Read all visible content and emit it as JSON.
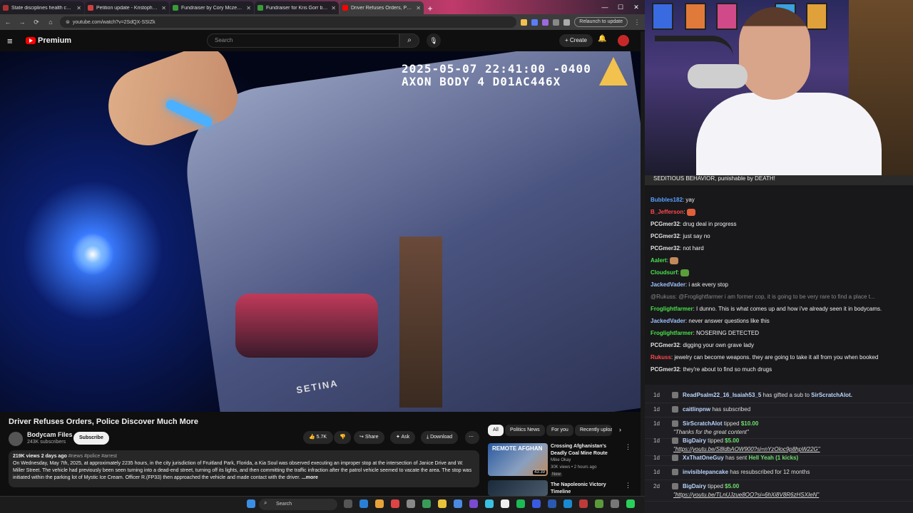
{
  "browser": {
    "tabs": [
      {
        "title": "State disciplines health care pr",
        "color": "#b03030"
      },
      {
        "title": "Petition update - Kristopher's s",
        "color": "#d04040"
      },
      {
        "title": "Fundraiser by Cory Mczenna",
        "color": "#3a9a3a"
      },
      {
        "title": "Fundraiser for Kris Gorr by Kell",
        "color": "#3a9a3a"
      },
      {
        "title": "Driver Refuses Orders, Polic",
        "color": "#ff0000"
      }
    ],
    "new_tab": "+",
    "url": "youtube.com/watch?v=2SdQX-SSIZk",
    "relaunch": "Relaunch to update"
  },
  "youtube": {
    "premium_label": "Premium",
    "search_placeholder": "Search",
    "create_label": "Create",
    "video": {
      "overlay_line1": "2025-05-07 22:41:00 -0400",
      "overlay_line2": "AXON BODY 4 D01AC446X",
      "car_text": "SETINA"
    },
    "title": "Driver Refuses Orders, Police Discover Much More",
    "channel": "Bodycam Files",
    "subscribers": "243K subscribers",
    "subscribe": "Subscribe",
    "likes": "5.7K",
    "share": "Share",
    "ask": "Ask",
    "download": "Download",
    "description": {
      "stats": "219K views  2 days ago",
      "tags": "#news #police #arrest",
      "text": "On Wednesday, May 7th, 2025, at approximately 2235 hours, in the city jurisdiction of Fruitland Park, Florida, a Kia Soul was observed executing an improper stop at the intersection of Janice Drive and W. Miller Street. The vehicle had previously been seen turning into a dead-end street, turning off its lights, and then committing the traffic infraction after the patrol vehicle seemed to vacate the area. The stop was initiated within the parking lot of Mystic Ice Cream. Officer R.(FP33) then approached the vehicle and made contact with the driver.",
      "more": "...more"
    },
    "chips": [
      "All",
      "Politics News",
      "For you",
      "Recently uploa"
    ],
    "recs": [
      {
        "title": "Crossing Afghanistan's Deadly Coal Mine Route",
        "channel": "Mike Okay",
        "meta": "30K views • 2 hours ago",
        "badge": "New",
        "duration": "43:39",
        "thumb_text": "REMOTE AFGHAN"
      },
      {
        "title": "The Napoleonic Victory Timeline",
        "channel": "",
        "meta": "",
        "badge": "",
        "duration": "",
        "thumb_text": ""
      }
    ]
  },
  "taskbar": {
    "search": "Search"
  },
  "stream": {
    "pinned": "SEDITIOUS BEHAVIOR, punishable by DEATH!",
    "chat": [
      {
        "user": "Bubbles182",
        "color": "#5aa0ff",
        "msg": "yay"
      },
      {
        "user": "B_Jefferson",
        "color": "#ff4a4a",
        "msg": "",
        "emote": true
      },
      {
        "user": "PCGmer32",
        "color": "#e0e0e0",
        "msg": "drug deal in progress"
      },
      {
        "user": "PCGmer32",
        "color": "#e0e0e0",
        "msg": "just say no"
      },
      {
        "user": "PCGmer32",
        "color": "#e0e0e0",
        "msg": "not hard"
      },
      {
        "user": "Aalert",
        "color": "#4ae04a",
        "msg": "",
        "emote": true
      },
      {
        "user": "Cloudsurf",
        "color": "#4ae04a",
        "msg": "",
        "emote": true
      },
      {
        "user": "JackedVader",
        "color": "#9ec3ff",
        "msg": "i ask every stop"
      },
      {
        "user": "",
        "color": "#888888",
        "msg": "@Rukuss: @Froglightfarmer i am former cop, it is going to be very rare to find a place t..."
      },
      {
        "user": "Froglightfarmer",
        "color": "#4ae04a",
        "msg": "I dunno. This is what comes up and how i've already seen it in bodycams."
      },
      {
        "user": "JackedVader",
        "color": "#9ec3ff",
        "msg": "never answer questions like this"
      },
      {
        "user": "Froglightfarmer",
        "color": "#4ae04a",
        "msg": "NOSERING DETECTED"
      },
      {
        "user": "PCGmer32",
        "color": "#e0e0e0",
        "msg": "digging your own grave lady"
      },
      {
        "user": "Rukuss",
        "color": "#ff4a4a",
        "msg": "jewelry can become weapons. they are going to take it all from you when booked"
      },
      {
        "user": "PCGmer32",
        "color": "#e0e0e0",
        "msg": "they're about to find so much drugs"
      }
    ],
    "events": [
      {
        "age": "1d",
        "name": "ReadPsalm22_16_Isaiah53_5",
        "action": "has gifted a sub to",
        "target": "SirScratchAlot.",
        "sub": ""
      },
      {
        "age": "1d",
        "name": "caitlinpnw",
        "action": "has subscribed",
        "target": "",
        "sub": ""
      },
      {
        "age": "1d",
        "name": "SirScratchAlot",
        "action": "tipped",
        "target": "$10.00",
        "sub": "\"Thanks for the great content\""
      },
      {
        "age": "1d",
        "name": "BigDairy",
        "action": "tipped",
        "target": "$5.00",
        "sub": "\"https://youtu.be/S8ldbAOW900?si=nYzOloc9p8hpW22G\""
      },
      {
        "age": "1d",
        "name": "XxThatOneGuy",
        "action": "has sent",
        "target": "Hell Yeah (1 kicks)",
        "sub": ""
      },
      {
        "age": "1d",
        "name": "invisiblepancake",
        "action": "has resubscribed for 12 months",
        "target": "",
        "sub": ""
      },
      {
        "age": "2d",
        "name": "BigDairy",
        "action": "tipped",
        "target": "$5.00",
        "sub": "\"https://youtu.be/TLnUJzue8OO?si=6hXi8V8R6zHSXIeN\""
      }
    ]
  }
}
